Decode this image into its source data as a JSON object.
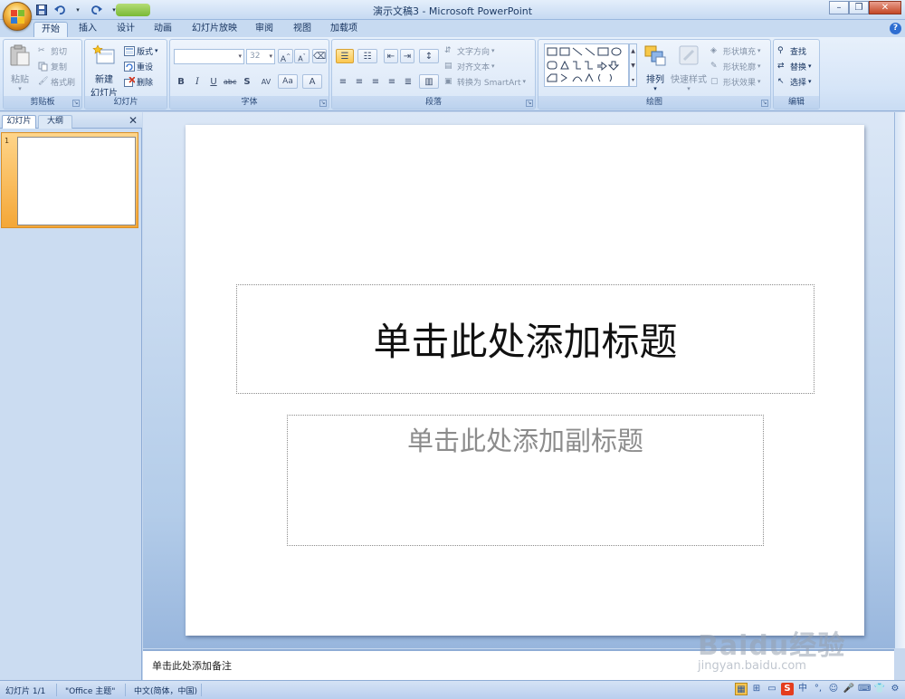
{
  "window": {
    "title": "演示文稿3 - Microsoft PowerPoint"
  },
  "tabs": [
    "开始",
    "插入",
    "设计",
    "动画",
    "幻灯片放映",
    "审阅",
    "视图",
    "加载项"
  ],
  "ribbon": {
    "clipboard": {
      "label": "剪贴板",
      "paste": "粘贴",
      "cut": "剪切",
      "copy": "复制",
      "format_painter": "格式刷"
    },
    "slides": {
      "label": "幻灯片",
      "new_slide": "新建",
      "new_slide2": "幻灯片",
      "layout": "版式",
      "reset": "重设",
      "delete": "删除"
    },
    "font": {
      "label": "字体",
      "font_name": "",
      "font_size": "32"
    },
    "paragraph": {
      "label": "段落",
      "text_direction": "文字方向",
      "align_text": "对齐文本",
      "smartart": "转换为 SmartArt"
    },
    "drawing": {
      "label": "绘图",
      "arrange": "排列",
      "quick_styles": "快速样式",
      "shape_fill": "形状填充",
      "shape_outline": "形状轮廓",
      "shape_effects": "形状效果"
    },
    "editing": {
      "label": "编辑",
      "find": "查找",
      "replace": "替换",
      "select": "选择"
    }
  },
  "left_pane": {
    "tab_slides": "幻灯片",
    "tab_outline": "大纲",
    "slide_number": "1"
  },
  "slide": {
    "title_placeholder": "单击此处添加标题",
    "subtitle_placeholder": "单击此处添加副标题"
  },
  "notes": {
    "placeholder": "单击此处添加备注"
  },
  "status": {
    "slide_count": "幻灯片 1/1",
    "theme": "\"Office 主题\"",
    "language": "中文(简体，中国)"
  },
  "watermark": {
    "text": "Baidu经验",
    "sub": "jingyan.baidu.com"
  }
}
